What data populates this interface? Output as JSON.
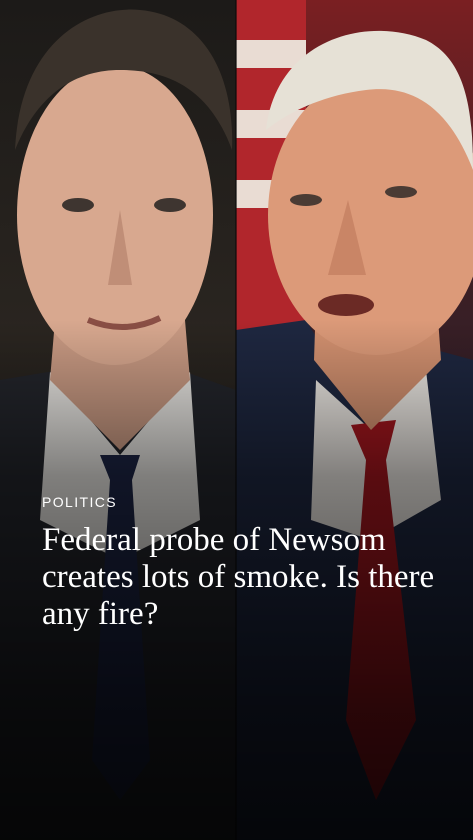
{
  "story": {
    "category": "POLITICS",
    "headline": "Federal probe of Newsom creates lots of smoke. Is there any fire?"
  },
  "photos": {
    "left": {
      "icon": "portrait-photo-icon"
    },
    "right": {
      "icon": "portrait-photo-icon"
    }
  }
}
